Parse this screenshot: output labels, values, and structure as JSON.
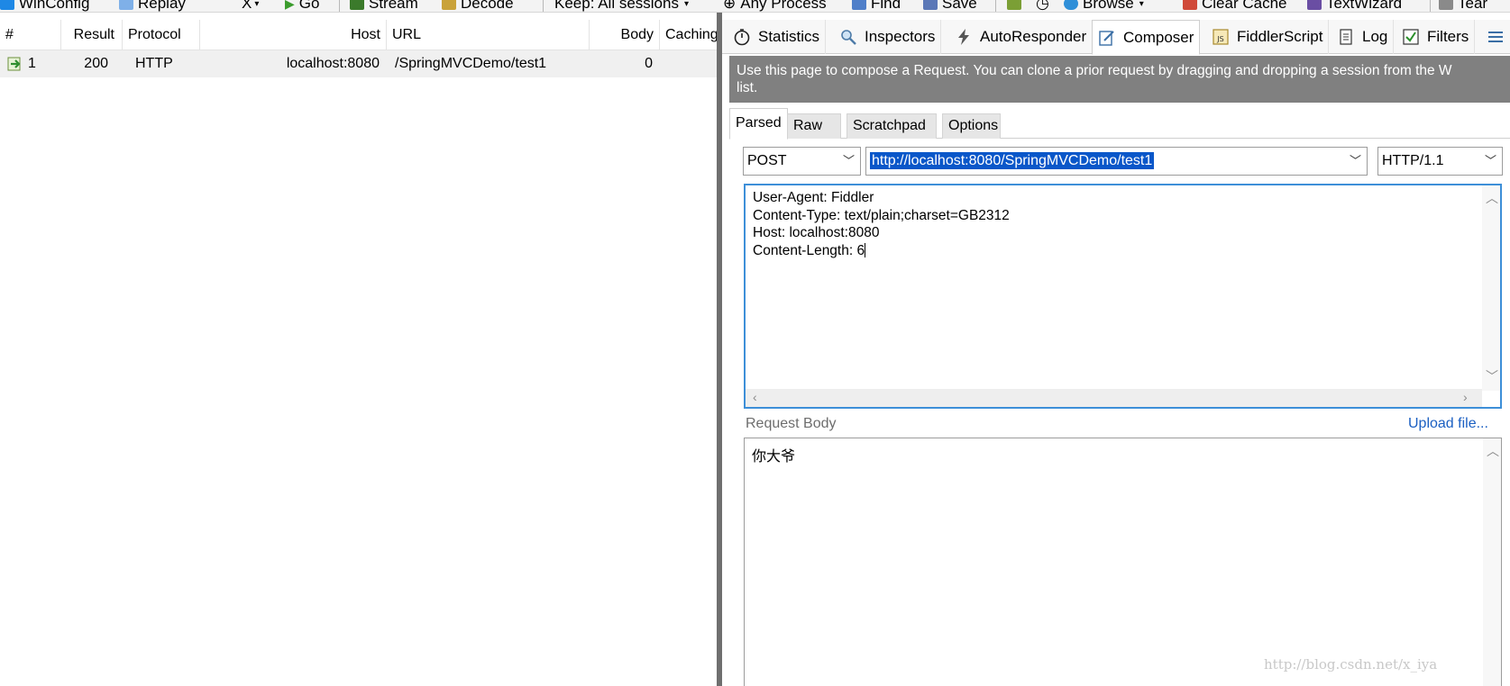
{
  "toolbar": {
    "winconfig": "WinConfig",
    "replay": "Replay",
    "remove": "X",
    "go": "Go",
    "stream": "Stream",
    "decode": "Decode",
    "keep": "Keep: All sessions",
    "any_process": "Any Process",
    "find": "Find",
    "save": "Save",
    "browse": "Browse",
    "clear_cache": "Clear Cache",
    "textwizard": "TextWizard",
    "tearoff": "Tear"
  },
  "sessions": {
    "columns": [
      "#",
      "Result",
      "Protocol",
      "Host",
      "URL",
      "Body",
      "Caching"
    ],
    "rows": [
      {
        "num": "1",
        "result": "200",
        "protocol": "HTTP",
        "host": "localhost:8080",
        "url": "/SpringMVCDemo/test1",
        "body": "0",
        "caching": ""
      }
    ]
  },
  "tabs": [
    "Statistics",
    "Inspectors",
    "AutoResponder",
    "Composer",
    "FiddlerScript",
    "Log",
    "Filters"
  ],
  "composer": {
    "info": "Use this page to compose a Request. You can clone a prior request by dragging and dropping a session from the W",
    "info_line2": "list.",
    "subtabs": [
      "Parsed",
      "Raw",
      "Scratchpad",
      "Options"
    ],
    "method": "POST",
    "url": "http://localhost:8080/SpringMVCDemo/test1",
    "version": "HTTP/1.1",
    "headers": [
      "User-Agent: Fiddler",
      "Content-Type: text/plain;charset=GB2312",
      "Host: localhost:8080",
      "Content-Length: 6"
    ],
    "request_body_label": "Request Body",
    "upload_link": "Upload file...",
    "body": "你大爷"
  },
  "watermark": "http://blog.csdn.net/x_iya",
  "colors": {
    "accent": "#3d8fd8",
    "info_bar": "#808080",
    "splitter": "#6f6f6f",
    "selection": "#0a57c9"
  }
}
